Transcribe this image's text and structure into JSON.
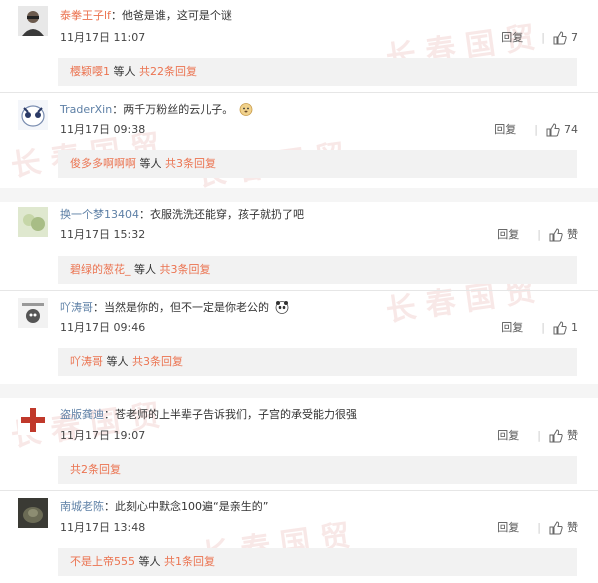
{
  "ui": {
    "reply_label": "回复",
    "like_zan": "赞",
    "people_suffix": "等人",
    "accent": "#eb7350"
  },
  "watermark": "长春国贸",
  "comments": [
    {
      "user": "泰拳王子lf",
      "text": "他爸是谁，这可是个谜",
      "date": "11月17日 11:07",
      "likes": "7",
      "sub": {
        "name": "樱颖嘤1",
        "people": "等人",
        "count": "共22条回复"
      }
    },
    {
      "user": "TraderXin",
      "text": "两千万粉丝的云儿子。",
      "date": "11月17日 09:38",
      "likes": "74",
      "sub": {
        "name": "俊多多啊啊啊",
        "people": "等人",
        "count": "共3条回复"
      }
    },
    {
      "user": "换一个梦13404",
      "text": "衣服洗洗还能穿，孩子就扔了吧",
      "date": "11月17日 15:32",
      "likes": "赞",
      "sub": {
        "name": "碧绿的葱花_",
        "people": "等人",
        "count": "共3条回复"
      }
    },
    {
      "user": "吖涛哥",
      "text": "当然是你的，但不一定是你老公的",
      "date": "11月17日 09:46",
      "likes": "1",
      "sub": {
        "name": "吖涛哥",
        "people": "等人",
        "count": "共3条回复"
      }
    },
    {
      "user": "盗版龚迪",
      "text": "苍老师的上半辈子告诉我们，子宫的承受能力很强",
      "date": "11月17日 19:07",
      "likes": "赞",
      "sub": {
        "name": "",
        "people": "",
        "count": "共2条回复"
      }
    },
    {
      "user": "南城老陈",
      "text": "此刻心中默念100遍“是亲生的”",
      "date": "11月17日 13:48",
      "likes": "赞",
      "sub": {
        "name": "不是上帝555",
        "people": "等人",
        "count": "共1条回复"
      }
    }
  ]
}
